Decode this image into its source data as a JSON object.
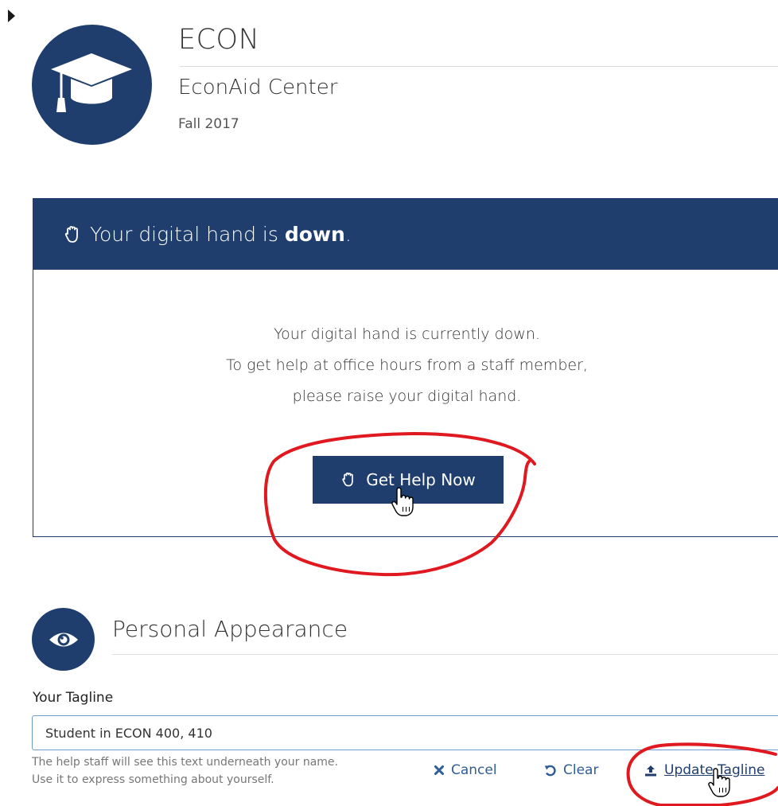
{
  "course": {
    "code": "ECON",
    "name": "EconAid Center",
    "term": "Fall 2017"
  },
  "hand_panel": {
    "header_prefix": "Your digital hand is",
    "header_status": "down",
    "header_suffix": ".",
    "body_lines": [
      "Your digital hand is currently down.",
      "To get help at office hours from a staff member,",
      "please raise your digital hand."
    ],
    "button_label": "Get Help Now"
  },
  "personal_appearance": {
    "title": "Personal Appearance",
    "tagline_label": "Your Tagline",
    "tagline_value": "Student in ECON 400, 410",
    "help_lines": [
      "The help staff will see this text underneath your name.",
      "Use it to express something about yourself."
    ],
    "actions": {
      "cancel": "Cancel",
      "clear": "Clear",
      "update": "Update Tagline"
    }
  },
  "icons": {
    "course_avatar": "graduation-cap-icon",
    "hand_header": "hand-icon",
    "help_button": "hand-icon",
    "personal_appearance": "eye-icon",
    "cancel": "times-icon",
    "clear": "undo-icon",
    "update": "upload-icon"
  },
  "colors": {
    "primary": "#1f3e6e",
    "link": "#2e5d99",
    "annotation": "#e0181f"
  }
}
